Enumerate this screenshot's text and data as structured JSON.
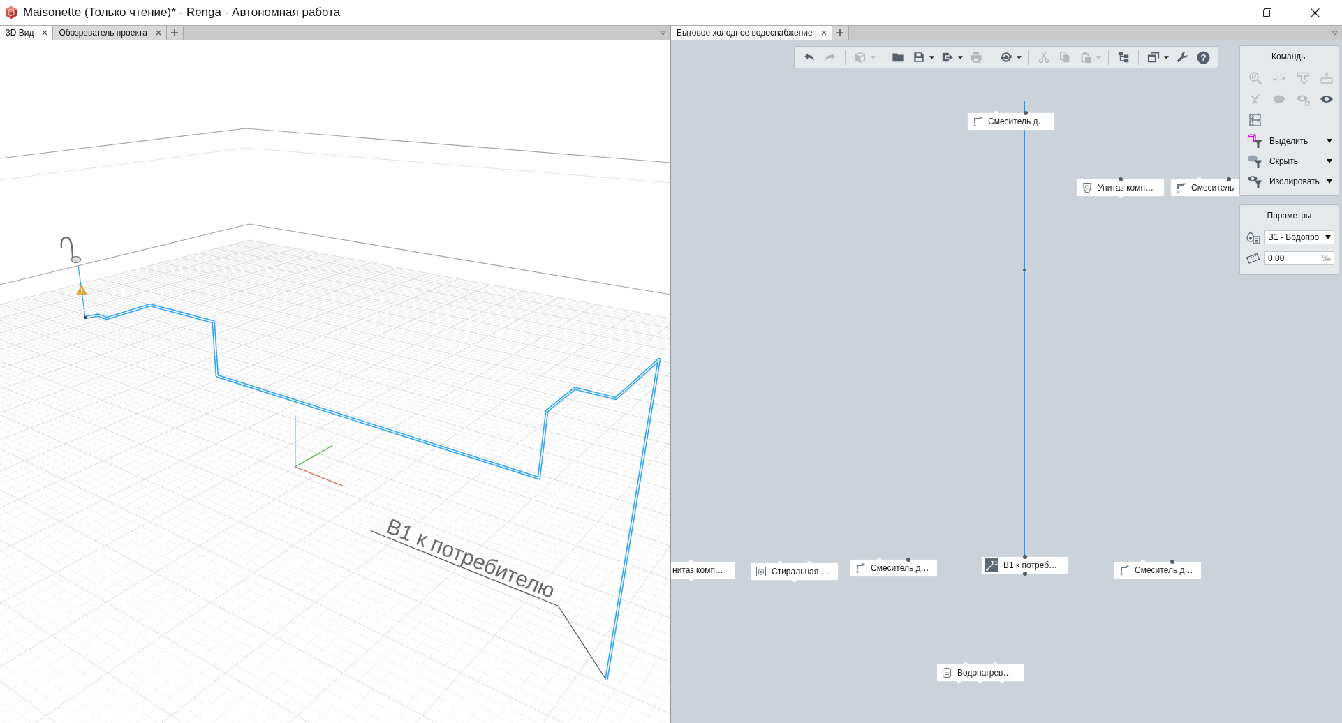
{
  "window": {
    "title": "Maisonette (Только чтение)* - Renga - Автономная работа"
  },
  "left_pane": {
    "tabs": [
      {
        "label": "3D Вид",
        "selected": true
      },
      {
        "label": "Обозреватель проекта",
        "selected": false
      }
    ],
    "view": {
      "pipe_label": "В1 к потребителю"
    }
  },
  "right_pane": {
    "tabs": [
      {
        "label": "Бытовое холодное водоснабжение",
        "selected": true
      }
    ],
    "toolbar": {
      "groups": [
        [
          {
            "disabled": false
          },
          {
            "disabled": true
          }
        ],
        [
          {
            "disabled": true,
            "menu": true
          }
        ],
        [
          {
            "disabled": false
          },
          {
            "disabled": false,
            "menu": true
          },
          {
            "disabled": false,
            "menu": true
          },
          {
            "disabled": true
          }
        ],
        [
          {
            "disabled": false,
            "menu": true
          }
        ],
        [
          {
            "disabled": true
          },
          {
            "disabled": true
          },
          {
            "disabled": true,
            "menu": true
          }
        ],
        [
          {
            "disabled": false
          }
        ],
        [
          {
            "disabled": false,
            "menu": true
          },
          {
            "disabled": false
          },
          {
            "disabled": false,
            "glyph": "?"
          }
        ]
      ]
    },
    "diagram": {
      "nodes": [
        {
          "kind": "mixer",
          "label": "Смеситель д…",
          "top_ports": [
            {
              "connected": false
            },
            {
              "connected": true
            }
          ]
        },
        {
          "kind": "toilet",
          "label": "Унитаз комп…",
          "top_ports": [
            {
              "connected": true
            }
          ],
          "bottom_ports": [
            {
              "connected": false
            }
          ]
        },
        {
          "kind": "mixer",
          "label": "Смеситель",
          "top_ports": [
            {
              "connected": false
            },
            {
              "connected": true
            }
          ]
        },
        {
          "kind": "partial",
          "label": "нитаз комп…",
          "top_ports": [
            {
              "connected": false
            }
          ],
          "bottom_ports": [
            {
              "connected": false
            }
          ]
        },
        {
          "kind": "washer",
          "label": "Стиральная …",
          "top_ports": [
            {
              "connected": false
            },
            {
              "connected": false
            }
          ],
          "bottom_ports": [
            {
              "connected": false
            }
          ]
        },
        {
          "kind": "mixer",
          "label": "Смеситель д…",
          "top_ports": [
            {
              "connected": false
            },
            {
              "connected": true
            }
          ]
        },
        {
          "kind": "system",
          "label": "В1 к потреб…",
          "badge": "T1",
          "top_ports": [
            {
              "connected": true
            }
          ],
          "bottom_ports": [
            {
              "connected": true
            }
          ]
        },
        {
          "kind": "mixer",
          "label": "Смеситель д…",
          "top_ports": [
            {
              "connected": false
            },
            {
              "connected": true
            }
          ]
        },
        {
          "kind": "heater",
          "label": "Водонагрев…",
          "top_ports": [
            {
              "connected": false
            },
            {
              "connected": false
            }
          ],
          "bottom_ports": [
            {
              "connected": false
            },
            {
              "connected": false
            },
            {
              "connected": false
            }
          ]
        }
      ]
    },
    "commands": {
      "title": "Команды",
      "buttons": [
        {
          "disabled": true
        },
        {
          "disabled": true
        },
        {
          "disabled": true
        },
        {
          "disabled": true
        },
        {
          "disabled": true
        },
        {
          "disabled": true
        },
        {
          "disabled": true
        },
        {
          "disabled": false
        },
        {
          "disabled": false,
          "marks": [
            "2",
            "1"
          ]
        }
      ],
      "menus": [
        {
          "label": "Выделить"
        },
        {
          "label": "Скрыть"
        },
        {
          "label": "Изолировать"
        }
      ]
    },
    "parameters": {
      "title": "Параметры",
      "system": {
        "value": "В1 - Водопро"
      },
      "slope": {
        "value": "0,00",
        "unit": "‰"
      }
    }
  }
}
